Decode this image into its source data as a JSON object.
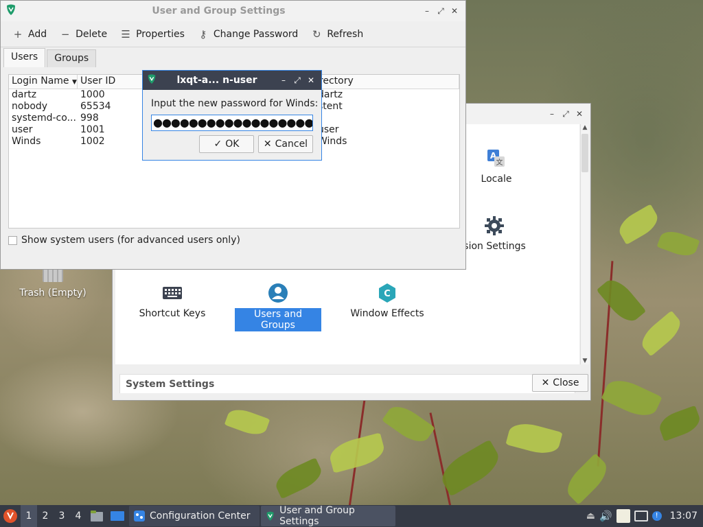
{
  "desktop": {
    "trash_label": "Trash (Empty)"
  },
  "config_center": {
    "items": {
      "locale": "Locale",
      "session": "ssion Settings",
      "shortcut_keys": "Shortcut Keys",
      "users_groups": "Users and Groups",
      "window_effects": "Window Effects"
    },
    "group_header": "System Settings",
    "close_label": "Close"
  },
  "user_group_settings": {
    "title": "User and Group Settings",
    "toolbar": {
      "add": "Add",
      "delete": "Delete",
      "properties": "Properties",
      "change_password": "Change Password",
      "refresh": "Refresh"
    },
    "tabs": {
      "users": "Users",
      "groups": "Groups"
    },
    "columns": {
      "login": "Login Name",
      "uid": "User ID",
      "dir": "irectory"
    },
    "rows": [
      {
        "login": "dartz",
        "uid": "1000",
        "dir": "dartz"
      },
      {
        "login": "nobody",
        "uid": "65534",
        "dir": "stent"
      },
      {
        "login": "systemd-co...",
        "uid": "998",
        "dir": ""
      },
      {
        "login": "user",
        "uid": "1001",
        "dir": "user"
      },
      {
        "login": "Winds",
        "uid": "1002",
        "dir": "Winds"
      }
    ],
    "show_system_users": "Show system users (for advanced users only)"
  },
  "password_dialog": {
    "title": "lxqt-a... n-user",
    "prompt": "Input the new password for Winds:",
    "password_mask": "●●●●●●●●●●●●●●●●●●●●●",
    "ok": "OK",
    "cancel": "Cancel"
  },
  "taskbar": {
    "desktops": [
      "1",
      "2",
      "3",
      "4"
    ],
    "tasks": {
      "config_center": "Configuration Center",
      "user_group": "User and Group Settings"
    },
    "clock": "13:07"
  },
  "colors": {
    "accent": "#3584e4",
    "taskbar": "#353a45",
    "dialog_titlebar": "#3c4250",
    "app_icon": "#1f9c6b"
  }
}
